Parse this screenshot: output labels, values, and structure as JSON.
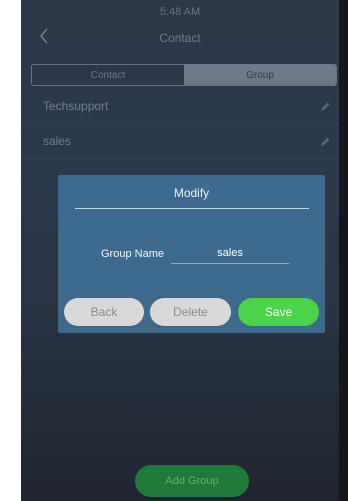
{
  "status_bar": {
    "time": "5:48 AM"
  },
  "header": {
    "title": "Contact"
  },
  "tabs": [
    {
      "label": "Contact"
    },
    {
      "label": "Group"
    }
  ],
  "groups": [
    {
      "name": "Techsupport"
    },
    {
      "name": "sales"
    }
  ],
  "add_group_label": "Add Group",
  "dialog": {
    "title": "Modify",
    "field_label": "Group Name",
    "field_value": "sales",
    "back_label": "Back",
    "delete_label": "Delete",
    "save_label": "Save"
  },
  "colors": {
    "accent_green": "#4bd44b",
    "dialog_bg": "#3d6a8b"
  },
  "icons": {
    "back": "chevron-left-icon",
    "edit": "pencil-icon"
  }
}
